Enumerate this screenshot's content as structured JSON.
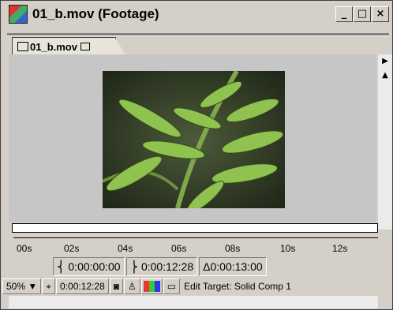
{
  "window": {
    "title": "01_b.mov (Footage)"
  },
  "window_controls": {
    "minimize": "_",
    "maximize": "□",
    "close": "×"
  },
  "tab": {
    "label": "01_b.mov"
  },
  "timeline": {
    "ruler_labels": [
      "00s",
      "02s",
      "04s",
      "06s",
      "08s",
      "10s",
      "12s"
    ]
  },
  "timecodes": {
    "in_point": "0:00:00:00",
    "out_point": "0:00:12:28",
    "duration": "Δ0:00:13:00"
  },
  "bottom_bar": {
    "zoom": "50%",
    "current_time": "0:00:12:28",
    "edit_target": "Edit Target: Solid Comp 1"
  },
  "colors": {
    "chrome": "#d4d0c8",
    "viewer_bg": "#c6c6c6"
  }
}
